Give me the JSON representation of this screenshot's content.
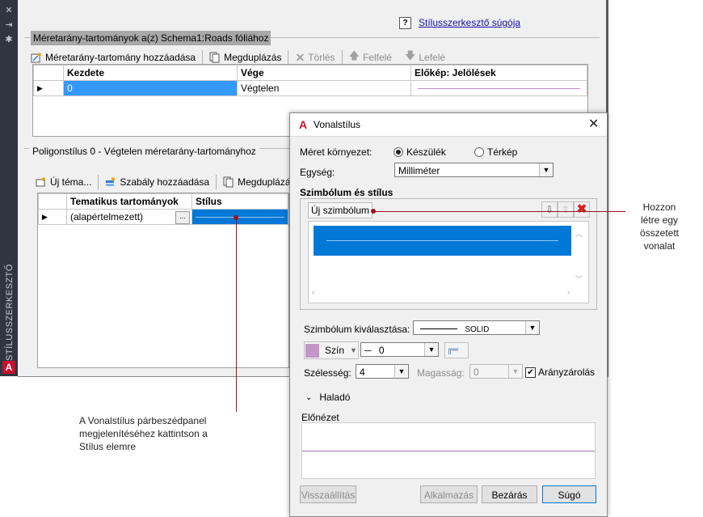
{
  "sidebar": {
    "vertical_label": "STÍLUSSZERKESZTŐ"
  },
  "help": {
    "icon_text": "?",
    "link": "Stílusszerkesztő súgója"
  },
  "scale": {
    "title": "Méretarány-tartományok a(z) Schema1:Roads fóliához",
    "toolbar": {
      "add": "Méretarány-tartomány hozzáadása",
      "duplicate": "Megduplázás",
      "delete": "Törlés",
      "up": "Felfelé",
      "down": "Lefelé"
    },
    "columns": [
      "Kezdete",
      "Vége",
      "Előkép: Jelölések"
    ],
    "row": {
      "start": "0",
      "end": "Végtelen"
    }
  },
  "poly": {
    "title": "Poligonstílus 0 - Végtelen méretarány-tartományhoz",
    "toolbar": {
      "theme": "Új téma...",
      "rule": "Szabály hozzáadása",
      "duplicate": "Megduplázás"
    },
    "columns": [
      "Tematikus tartományok",
      "Stílus"
    ],
    "row": {
      "theme": "(alapértelmezett)",
      "ellipsis": "..."
    }
  },
  "dialog": {
    "title": "Vonalstílus",
    "env_label": "Méret környezet:",
    "env_device": "Készülék",
    "env_map": "Térkép",
    "unit_label": "Egység:",
    "unit_value": "Milliméter",
    "symbol_section": "Szimbólum és stílus",
    "new_symbol": "Új szimbólum",
    "symbol_select_label": "Szimbólum kiválasztása:",
    "symbol_value": "SOLID",
    "color_label": "Szín",
    "thickness_value": "0",
    "width_label": "Szélesség:",
    "width_value": "4",
    "height_label": "Magasság:",
    "height_value": "0",
    "aspect_label": "Arányzárolás",
    "advanced": "Haladó",
    "preview": "Előnézet",
    "buttons": {
      "reset": "Visszaállítás",
      "apply": "Alkalmazás",
      "close": "Bezárás",
      "help": "Súgó"
    },
    "colors": {
      "swatch": "#c495c8",
      "selection": "#0078d7",
      "preview_line": "#a070a8"
    }
  },
  "callouts": {
    "right": [
      "Hozzon",
      "létre egy",
      "összetett",
      "vonalat"
    ],
    "bottom": [
      "A Vonalstílus párbeszédpanel",
      "megjelenítéséhez kattintson a",
      "Stílus elemre"
    ],
    "line_color": "#a01020"
  }
}
